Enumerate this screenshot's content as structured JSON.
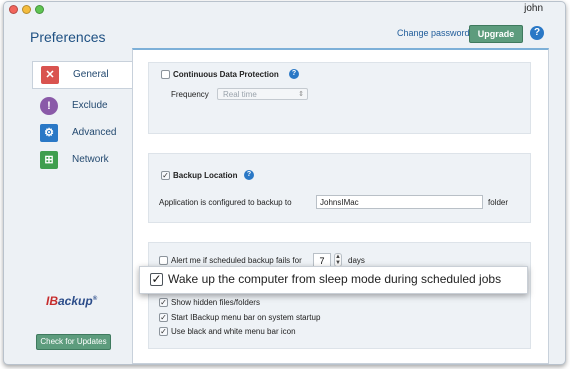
{
  "window": {
    "username": "john",
    "title": "Preferences"
  },
  "header": {
    "change_password": "Change password",
    "upgrade": "Upgrade"
  },
  "sidebar": {
    "items": [
      {
        "label": "General",
        "icon": "tools-icon",
        "color": "#d9534f"
      },
      {
        "label": "Exclude",
        "icon": "exclude-icon",
        "color": "#8a5aa8"
      },
      {
        "label": "Advanced",
        "icon": "gear-icon",
        "color": "#2a78c6"
      },
      {
        "label": "Network",
        "icon": "network-icon",
        "color": "#3f9e4e"
      }
    ]
  },
  "logo": {
    "part1": "IB",
    "part2": "ackup",
    "mark": "®"
  },
  "check_updates": "Check for Updates",
  "cdp": {
    "label": "Continuous Data Protection",
    "checked": false,
    "frequency_label": "Frequency",
    "frequency_value": "Real time"
  },
  "backup_location": {
    "label": "Backup Location",
    "checked": true,
    "configured_text": "Application is configured to backup to",
    "computer_name": "JohnsIMac",
    "suffix": "folder"
  },
  "options": {
    "alert_label": "Alert me if scheduled backup fails for",
    "alert_days": "7",
    "days_label": "days",
    "wake_label": "Wake up the computer from sleep mode during scheduled jobs",
    "hidden_label": "Show hidden files/folders",
    "menubar_label": "Start IBackup menu bar on system startup",
    "bw_label": "Use black and white menu bar icon"
  }
}
